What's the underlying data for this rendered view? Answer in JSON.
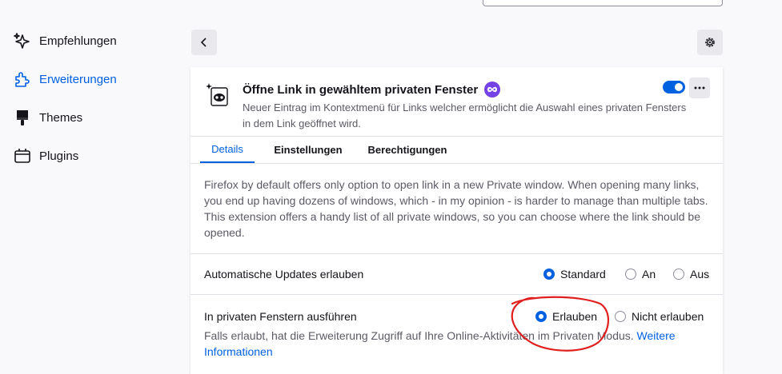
{
  "sidebar": {
    "items": [
      {
        "label": "Empfehlungen",
        "icon": "sparkles-icon"
      },
      {
        "label": "Erweiterungen",
        "icon": "puzzle-icon",
        "active": true
      },
      {
        "label": "Themes",
        "icon": "paintbrush-icon"
      },
      {
        "label": "Plugins",
        "icon": "plugin-icon"
      }
    ]
  },
  "extension": {
    "title": "Öffne Link in gewähltem privaten Fenster",
    "description": "Neuer Eintrag im Kontextmenü für Links welcher ermöglicht die Auswahl eines privaten Fensters in dem Link geöffnet wird.",
    "enabled": true,
    "long_description": "Firefox by default offers only option to open link in a new Private window. When opening many links, you end up having dozens of windows, which - in my opinion - is harder to manage than multiple tabs. This extension offers a handy list of all private windows, so you can choose where the link should be opened."
  },
  "tabs": [
    {
      "label": "Details",
      "active": true
    },
    {
      "label": "Einstellungen"
    },
    {
      "label": "Berechtigungen"
    }
  ],
  "updates": {
    "label": "Automatische Updates erlauben",
    "options": [
      "Standard",
      "An",
      "Aus"
    ],
    "selected": "Standard"
  },
  "private_browsing": {
    "label": "In privaten Fenstern ausführen",
    "options": [
      "Erlauben",
      "Nicht erlauben"
    ],
    "selected": "Erlauben",
    "description": "Falls erlaubt, hat die Erweiterung Zugriff auf Ihre Online-Aktivitäten im Privaten Modus.",
    "link": "Weitere Informationen"
  },
  "colors": {
    "accent": "#0061e0",
    "badge": "#7542e5",
    "annotation": "#e0201f"
  }
}
